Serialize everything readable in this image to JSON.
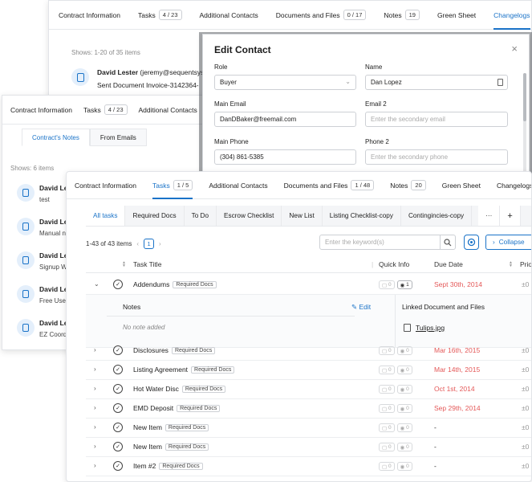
{
  "panelA": {
    "tabs": [
      {
        "label": "Contract Information"
      },
      {
        "label": "Tasks",
        "badge": "4 / 23"
      },
      {
        "label": "Additional Contacts"
      },
      {
        "label": "Documents and Files",
        "badge": "0 / 17"
      },
      {
        "label": "Notes",
        "badge": "19"
      },
      {
        "label": "Green Sheet"
      },
      {
        "label": "Changelogs",
        "active": true
      }
    ],
    "shows": "Shows: 1-20 of 35 items",
    "entry_name": "David Lester",
    "entry_email": "(jeremy@sequentsys.",
    "entry_text": "Sent Document Invoice-3142364-"
  },
  "panelB": {
    "tabs": [
      {
        "label": "Contract Information"
      },
      {
        "label": "Tasks",
        "badge": "4 / 23"
      },
      {
        "label": "Additional Contacts"
      }
    ],
    "subtabs": [
      "Contract's Notes",
      "From Emails"
    ],
    "shows": "Shows: 6 items",
    "notes": [
      {
        "name": "David Les",
        "text": "test"
      },
      {
        "name": "David Les",
        "text": "Manual no"
      },
      {
        "name": "David Les",
        "text": "Signup W"
      },
      {
        "name": "David Les",
        "text": "Free User"
      },
      {
        "name": "David Les",
        "text": "EZ Coordi"
      }
    ]
  },
  "modal": {
    "title": "Edit Contact",
    "close": "×",
    "fields": {
      "role_label": "Role",
      "role_value": "Buyer",
      "name_label": "Name",
      "name_value": "Dan Lopez",
      "email_label": "Main Email",
      "email_value": "DanDBaker@freemail.com",
      "email2_label": "Email 2",
      "email2_placeholder": "Enter the secondary email",
      "phone_label": "Main Phone",
      "phone_value": "(304) 861-5385",
      "phone2_label": "Phone 2",
      "phone2_placeholder": "Enter the secondary phone"
    }
  },
  "panelC": {
    "tabs": [
      {
        "label": "Contract Information"
      },
      {
        "label": "Tasks",
        "badge": "1 / 5",
        "active": true
      },
      {
        "label": "Additional Contacts"
      },
      {
        "label": "Documents and Files",
        "badge": "1 / 48"
      },
      {
        "label": "Notes",
        "badge": "20"
      },
      {
        "label": "Green Sheet"
      },
      {
        "label": "Changelogs"
      }
    ],
    "task_tabs": [
      "All tasks",
      "Required Docs",
      "To Do",
      "Escrow Checklist",
      "New List",
      "Listing Checklist-copy",
      "Contingincies-copy"
    ],
    "more": "···",
    "add": "+",
    "pager_text": "1-43 of 43 items",
    "page": "1",
    "search_placeholder": "Enter the keyword(s)",
    "collapse_label": "Collapse",
    "columns": {
      "title": "Task Title",
      "quick": "Quick Info",
      "due": "Due Date",
      "priority": "Prio"
    },
    "expanded": {
      "notes_header": "Notes",
      "edit_label": "Edit",
      "no_note": "No note added",
      "linked_header": "Linked Document and Files",
      "file_name": "Tulips.jpg"
    },
    "rows": [
      {
        "title": "Addendums",
        "tag": "Required Docs",
        "q1": "0",
        "q2": "1",
        "due": "Sept 30th, 2014",
        "pri": "±0"
      },
      {
        "title": "Disclosures",
        "tag": "Required Docs",
        "q1": "0",
        "q2": "0",
        "due": "Mar 16th, 2015",
        "pri": "±0"
      },
      {
        "title": "Listing Agreement",
        "tag": "Required Docs",
        "q1": "0",
        "q2": "0",
        "due": "Mar 14th, 2015",
        "pri": "±0"
      },
      {
        "title": "Hot Water Disc",
        "tag": "Required Docs",
        "q1": "0",
        "q2": "0",
        "due": "Oct 1st, 2014",
        "pri": "±0"
      },
      {
        "title": "EMD Deposit",
        "tag": "Required Docs",
        "q1": "0",
        "q2": "0",
        "due": "Sep 29th, 2014",
        "pri": "±0"
      },
      {
        "title": "New Item",
        "tag": "Required Docs",
        "q1": "0",
        "q2": "0",
        "due": "-",
        "pri": "±0"
      },
      {
        "title": "New Item",
        "tag": "Required Docs",
        "q1": "0",
        "q2": "0",
        "due": "-",
        "pri": "±0"
      },
      {
        "title": "Item #2",
        "tag": "Required Docs",
        "q1": "0",
        "q2": "0",
        "due": "-",
        "pri": "±0"
      }
    ]
  }
}
